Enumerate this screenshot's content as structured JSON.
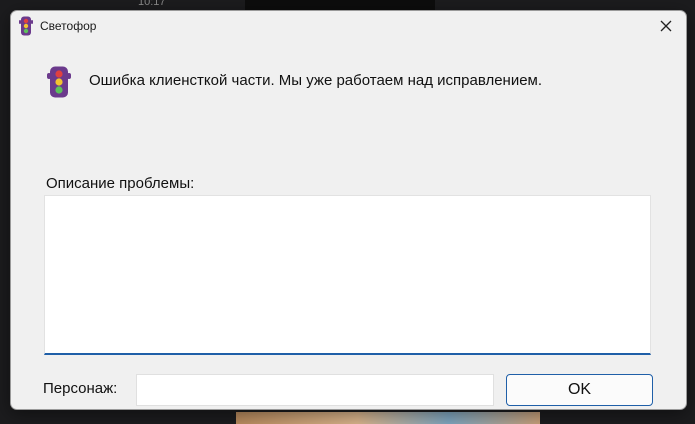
{
  "background": {
    "clock_text": "10:17"
  },
  "window": {
    "title": "Светофор",
    "icon": "traffic-light-icon",
    "close_icon": "close-icon"
  },
  "message": {
    "icon": "traffic-light-icon",
    "text": "Ошибка клиенсткой части. Мы уже работаем над исправлением."
  },
  "description": {
    "label": "Описание проблемы:",
    "value": ""
  },
  "character": {
    "label": "Персонаж:",
    "value": ""
  },
  "ok_button": {
    "label": "OK"
  },
  "colors": {
    "accent": "#1f5fa8",
    "light_housing": "#6b3a8c",
    "light_red": "#e04040",
    "light_yellow": "#f2c230",
    "light_green": "#5cc05c"
  }
}
